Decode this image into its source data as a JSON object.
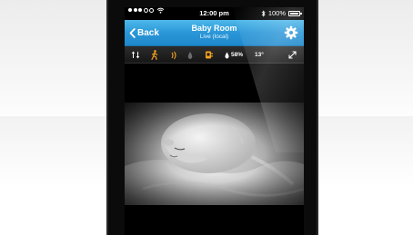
{
  "status_bar": {
    "time": "12:00 pm",
    "battery": "100%",
    "icons": [
      "signal-dots-icon",
      "wifi-icon",
      "bluetooth-icon",
      "battery-icon"
    ]
  },
  "nav": {
    "back_label": "Back",
    "title": "Baby Room",
    "subtitle": "Live (local)",
    "settings_icon": "gear-icon"
  },
  "toolbar": {
    "icons": [
      "arrows-updown-icon",
      "motion-person-icon",
      "sound-waves-icon",
      "drop-icon",
      "light-plug-icon",
      "humidity-drop-icon"
    ],
    "humidity": "58%",
    "temperature": "13°",
    "fullscreen_icon": "expand-icon"
  },
  "video": {
    "content": "baby-sleeping-feed"
  },
  "colors": {
    "nav_blue": "#2a97d8",
    "accent_orange": "#f2a11f",
    "toolbar_dark": "#1e1e1e"
  }
}
